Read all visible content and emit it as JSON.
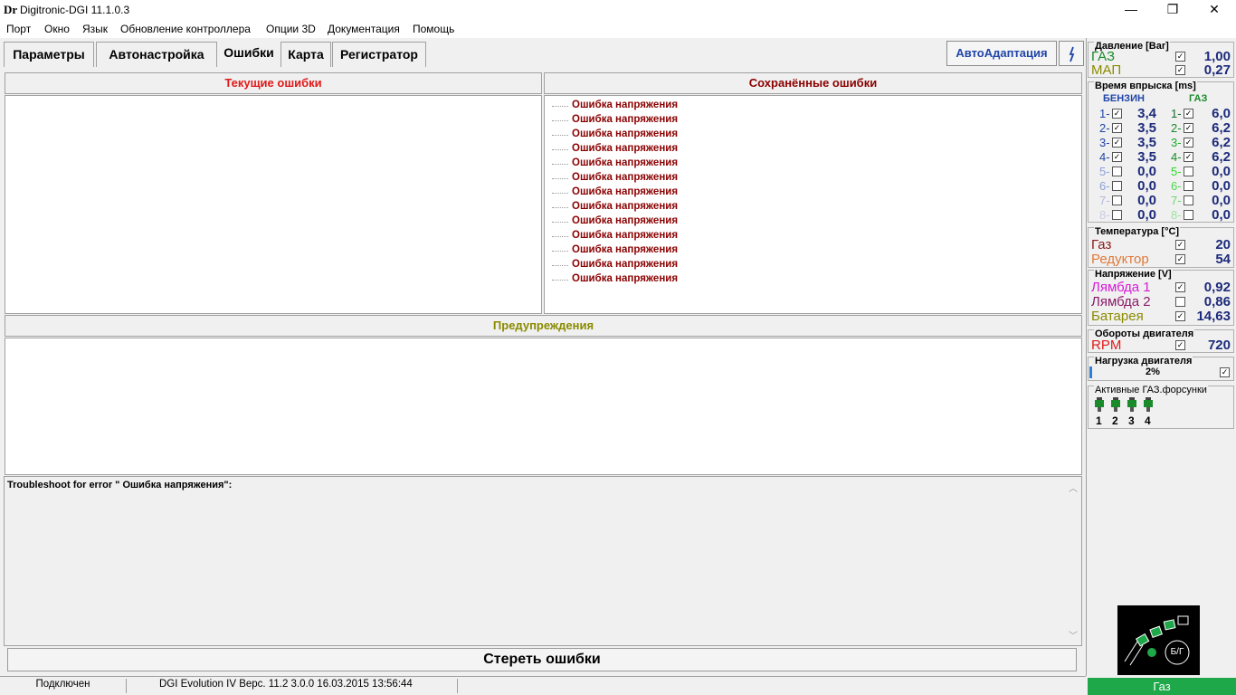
{
  "window": {
    "logo": "Dr",
    "title": "Digitronic-DGI  11.1.0.3",
    "minimize": "—",
    "maximize": "❐",
    "close": "✕"
  },
  "menu": [
    "Порт",
    "Окно",
    "Язык",
    "Обновление контроллера",
    "Опции 3D",
    "Документация",
    "Помощь"
  ],
  "tabs": [
    "Параметры",
    "Автонастройка",
    "Ошибки",
    "Карта",
    "Регистратор"
  ],
  "active_tab": "Ошибки",
  "toolbar": {
    "auto_adapt_label": "АвтоАдаптация"
  },
  "panels": {
    "current_errors_title": "Текущие ошибки",
    "saved_errors_title": "Сохранённые ошибки",
    "warnings_title": "Предупреждения",
    "saved_errors": [
      "Ошибка напряжения",
      "Ошибка напряжения",
      "Ошибка напряжения",
      "Ошибка напряжения",
      "Ошибка напряжения",
      "Ошибка напряжения",
      "Ошибка напряжения",
      "Ошибка напряжения",
      "Ошибка напряжения",
      "Ошибка напряжения",
      "Ошибка напряжения",
      "Ошибка напряжения",
      "Ошибка напряжения"
    ],
    "troubleshoot_text": "Troubleshoot for error \"  Ошибка напряжения\":"
  },
  "erase_button": "Стереть ошибки",
  "status": {
    "connection": "Подключен",
    "device": "DGI Evolution IV  Верс. 11.2  3.0.0    16.03.2015 13:56:44",
    "mode": "Газ"
  },
  "sidebar": {
    "pressure": {
      "title": "Давление [Bar]",
      "rows": [
        {
          "label": "ГАЗ",
          "value": "1,00",
          "color": "#1a8a2a"
        },
        {
          "label": "МАП",
          "value": "0,27",
          "color": "#8b8b00"
        }
      ]
    },
    "injection": {
      "title": "Время впрыска [ms]",
      "petrol_header": "БЕНЗИН",
      "gas_header": "ГАЗ",
      "petrol": [
        {
          "n": "1-",
          "value": "3,4",
          "active": true
        },
        {
          "n": "2-",
          "value": "3,5",
          "active": true
        },
        {
          "n": "3-",
          "value": "3,5",
          "active": true
        },
        {
          "n": "4-",
          "value": "3,5",
          "active": true
        },
        {
          "n": "5-",
          "value": "0,0",
          "active": false
        },
        {
          "n": "6-",
          "value": "0,0",
          "active": false
        },
        {
          "n": "7-",
          "value": "0,0",
          "active": false
        },
        {
          "n": "8-",
          "value": "0,0",
          "active": false
        }
      ],
      "gas": [
        {
          "n": "1-",
          "value": "6,0",
          "active": true
        },
        {
          "n": "2-",
          "value": "6,2",
          "active": true
        },
        {
          "n": "3-",
          "value": "6,2",
          "active": true
        },
        {
          "n": "4-",
          "value": "6,2",
          "active": true
        },
        {
          "n": "5-",
          "value": "0,0",
          "active": false
        },
        {
          "n": "6-",
          "value": "0,0",
          "active": false
        },
        {
          "n": "7-",
          "value": "0,0",
          "active": false
        },
        {
          "n": "8-",
          "value": "0,0",
          "active": false
        }
      ]
    },
    "temperature": {
      "title": "Температура  [°C]",
      "rows": [
        {
          "label": "Газ",
          "value": "20",
          "color": "#8b1a1a"
        },
        {
          "label": "Редуктор",
          "value": "54",
          "color": "#e07a3a"
        }
      ]
    },
    "voltage": {
      "title": "Напряжение [V]",
      "rows": [
        {
          "label": "Лямбда 1",
          "value": "0,92",
          "color": "#d81ad8",
          "checked": true
        },
        {
          "label": "Лямбда 2",
          "value": "0,86",
          "color": "#8b1a6a",
          "checked": false
        },
        {
          "label": "Батарея",
          "value": "14,63",
          "color": "#8b8b00",
          "checked": true
        }
      ]
    },
    "rpm": {
      "title": "Обороты двигателя",
      "label": "RPM",
      "value": "720",
      "color": "#e01a1a"
    },
    "load": {
      "title": "Нагрузка двигателя",
      "value": "2%",
      "fraction": 0.02
    },
    "active_injectors": {
      "title": "Активные ГАЗ.форсунки",
      "numbers": [
        "1",
        "2",
        "3",
        "4"
      ]
    },
    "switch": {
      "label": "Б/Г"
    }
  }
}
